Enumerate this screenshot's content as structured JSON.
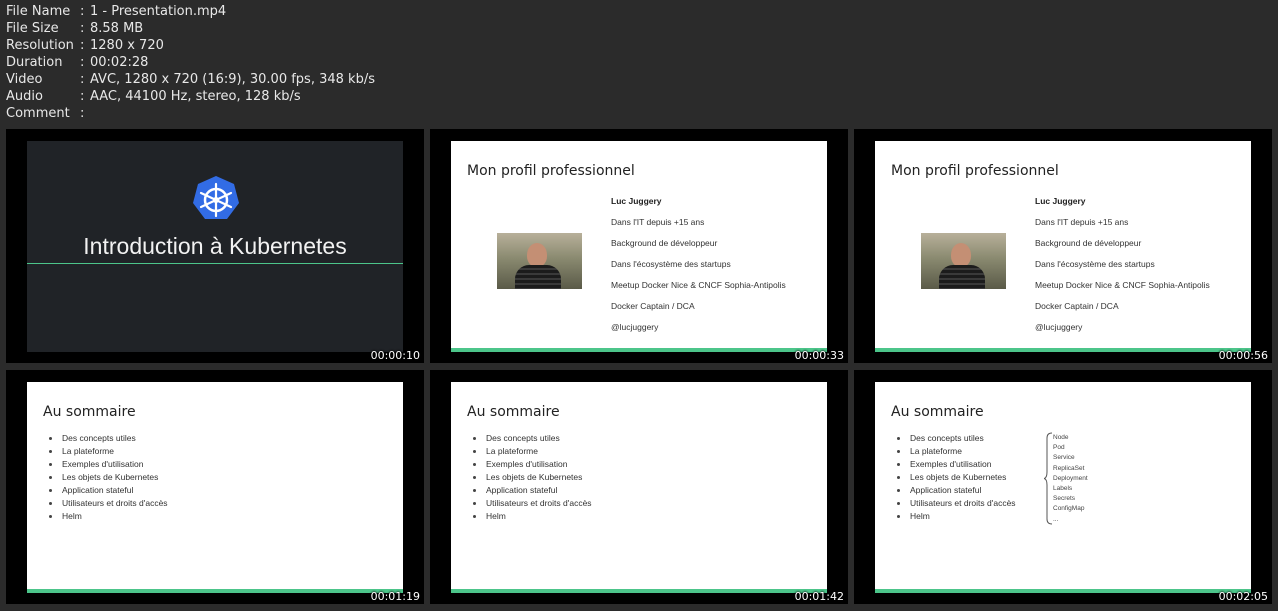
{
  "meta": [
    {
      "key": "File Name",
      "value": "1 - Presentation.mp4"
    },
    {
      "key": "File Size",
      "value": "8.58 MB"
    },
    {
      "key": "Resolution",
      "value": "1280 x 720"
    },
    {
      "key": "Duration",
      "value": "00:02:28"
    },
    {
      "key": "Video",
      "value": "AVC, 1280 x 720 (16:9), 30.00 fps, 348 kb/s"
    },
    {
      "key": "Audio",
      "value": "AAC, 44100 Hz, stereo, 128 kb/s"
    },
    {
      "key": "Comment",
      "value": ""
    }
  ],
  "meta_separator": ":",
  "colors": {
    "accent": "#4cc58a",
    "k8s_blue": "#326ce5",
    "background": "#2b2b2b"
  },
  "intro": {
    "title": "Introduction à Kubernetes",
    "icon": "kubernetes-helm-icon"
  },
  "profile": {
    "title": "Mon profil professionnel",
    "name": "Luc Juggery",
    "lines": [
      "Dans l'IT depuis +15 ans",
      "Background de développeur",
      "Dans l'écosystème des startups",
      "Meetup Docker Nice & CNCF Sophia-Antipolis",
      "Docker Captain / DCA",
      "@lucjuggery"
    ]
  },
  "summary": {
    "title": "Au sommaire",
    "items": [
      "Des concepts utiles",
      "La plateforme",
      "Exemples d'utilisation",
      "Les objets de Kubernetes",
      "Application stateful",
      "Utilisateurs et droits d'accès",
      "Helm"
    ],
    "objects": [
      "Node",
      "Pod",
      "Service",
      "ReplicaSet",
      "Deployment",
      "Labels",
      "Secrets",
      "ConfigMap",
      "..."
    ]
  },
  "thumbnails": [
    {
      "timestamp": "00:00:10"
    },
    {
      "timestamp": "00:00:33"
    },
    {
      "timestamp": "00:00:56"
    },
    {
      "timestamp": "00:01:19"
    },
    {
      "timestamp": "00:01:42"
    },
    {
      "timestamp": "00:02:05"
    }
  ]
}
